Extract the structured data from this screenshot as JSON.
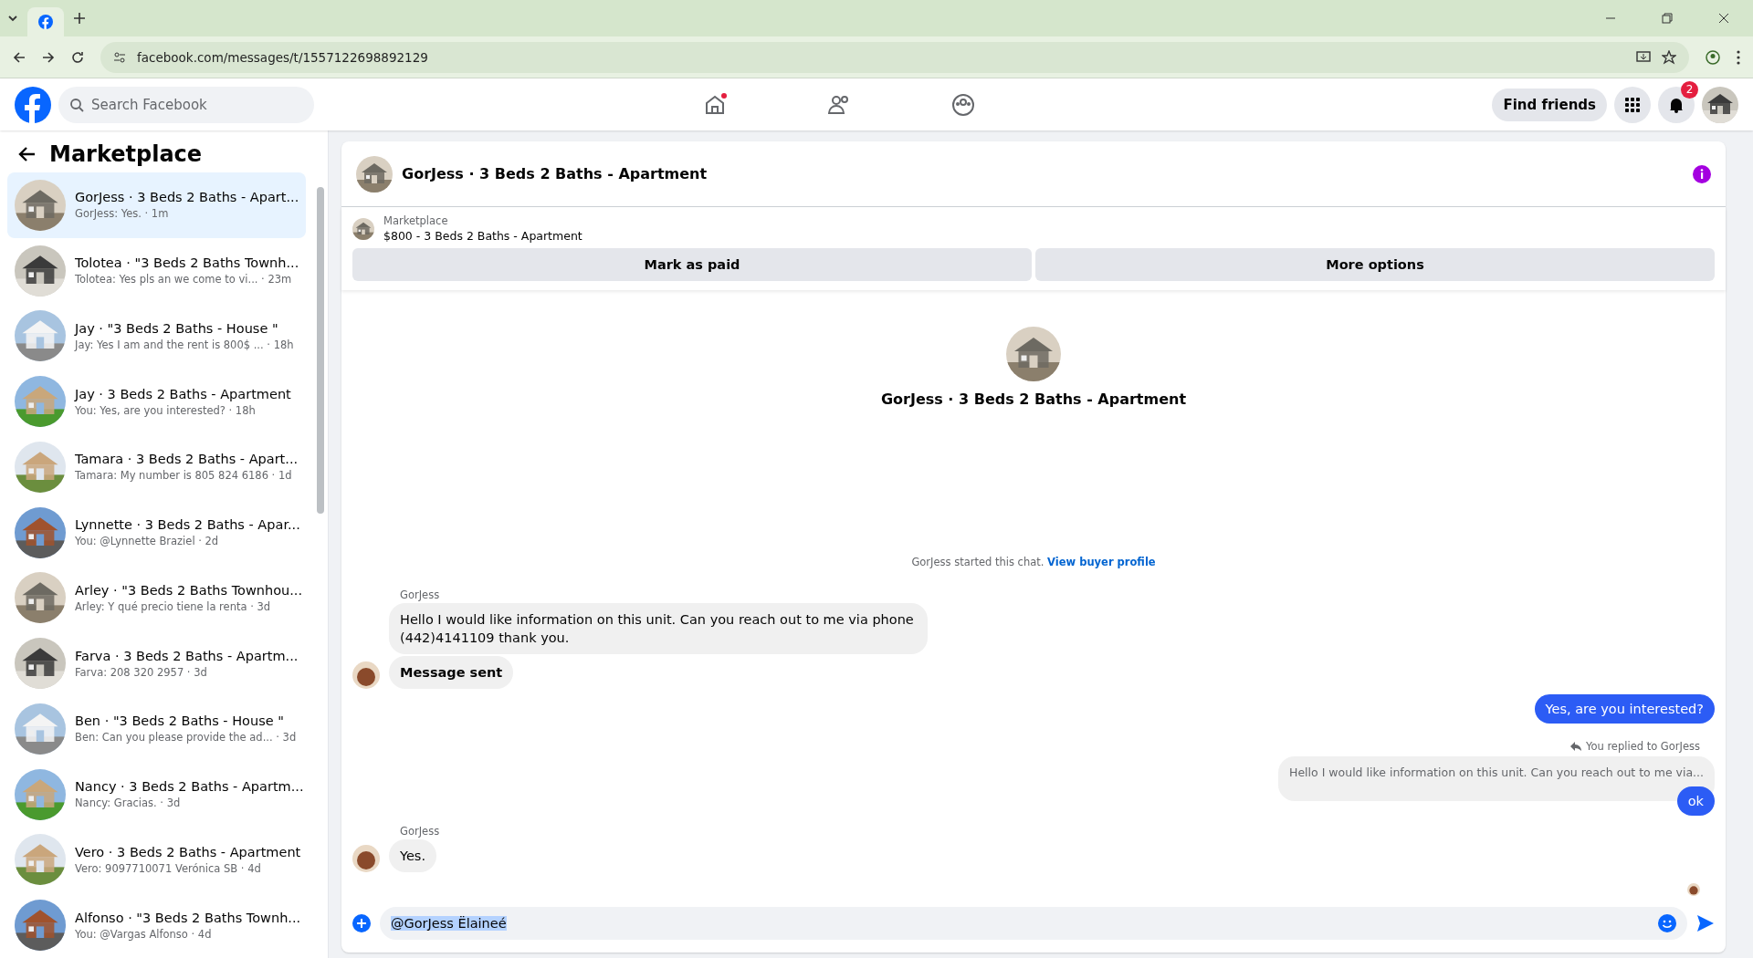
{
  "browser": {
    "url": "facebook.com/messages/t/1557122698892129"
  },
  "header": {
    "search_placeholder": "Search Facebook",
    "find_friends": "Find friends",
    "notification_count": "2"
  },
  "sidebar": {
    "title": "Marketplace",
    "conversations": [
      {
        "title": "GorJess · 3 Beds 2 Baths - Apart...",
        "preview": "GorJess: Yes. · 1m",
        "selected": true
      },
      {
        "title": "Tolotea · \"3 Beds 2 Baths Townh...",
        "preview": "Tolotea: Yes pls an we come to vi...  · 23m",
        "selected": false
      },
      {
        "title": "Jay · \"3 Beds 2 Baths - House \"",
        "preview": "Jay: Yes I am and the rent is 800$ ...  · 18h",
        "selected": false
      },
      {
        "title": "Jay · 3 Beds 2 Baths - Apartment",
        "preview": "You: Yes, are you interested? · 18h",
        "selected": false
      },
      {
        "title": "Tamara · 3 Beds 2 Baths - Apart...",
        "preview": "Tamara: My number is 805 824 6186 · 1d",
        "selected": false
      },
      {
        "title": "Lynnette · 3 Beds 2 Baths - Apar...",
        "preview": "You: @Lynnette Braziel · 2d",
        "selected": false
      },
      {
        "title": "Arley · \"3 Beds 2 Baths Townhou...",
        "preview": "Arley: Y qué precio tiene la renta · 3d",
        "selected": false
      },
      {
        "title": "Farva · 3 Beds 2 Baths - Apartm...",
        "preview": "Farva: 208 320 2957 · 3d",
        "selected": false
      },
      {
        "title": "Ben · \"3 Beds 2 Baths - House \"",
        "preview": "Ben: Can you please provide the ad... · 3d",
        "selected": false
      },
      {
        "title": "Nancy · 3 Beds 2 Baths - Apartm...",
        "preview": "Nancy: Gracias. · 3d",
        "selected": false
      },
      {
        "title": "Vero · 3 Beds 2 Baths - Apartment",
        "preview": "Vero: 9097710071 Verónica SB · 4d",
        "selected": false
      },
      {
        "title": "Alfonso · \"3 Beds 2 Baths Townh...",
        "preview": "You: @Vargas Alfonso · 4d",
        "selected": false
      }
    ]
  },
  "chat": {
    "title": "GorJess · 3 Beds 2 Baths - Apartment",
    "listing": {
      "label": "Marketplace",
      "summary": "$800 - 3 Beds 2 Baths - Apartment"
    },
    "buttons": [
      "Mark as paid",
      "More options"
    ],
    "intro_title": "GorJess · 3 Beds 2 Baths - Apartment",
    "started_text": "GorJess started this chat.",
    "profile_link": "View buyer profile",
    "messages": [
      {
        "kind": "sender",
        "text": "GorJess"
      },
      {
        "kind": "incoming",
        "text": "Hello I would like information on this unit. Can you reach out to me via phone (442)4141109 thank you.",
        "avatar": false,
        "bold": false
      },
      {
        "kind": "incoming",
        "text": "Message sent",
        "avatar": true,
        "bold": true
      },
      {
        "kind": "outgoing",
        "text": "Yes, are you interested?"
      },
      {
        "kind": "reply_note",
        "text": "You replied to GorJess"
      },
      {
        "kind": "quote",
        "text": "Hello I would like information on this unit. Can you reach out to me via..."
      },
      {
        "kind": "outgoing",
        "text": "ok"
      },
      {
        "kind": "sender",
        "text": "GorJess"
      },
      {
        "kind": "incoming",
        "text": "Yes.",
        "avatar": true,
        "bold": false
      },
      {
        "kind": "receipt"
      }
    ],
    "composer_value": "@GorJess Ëlaineé"
  }
}
